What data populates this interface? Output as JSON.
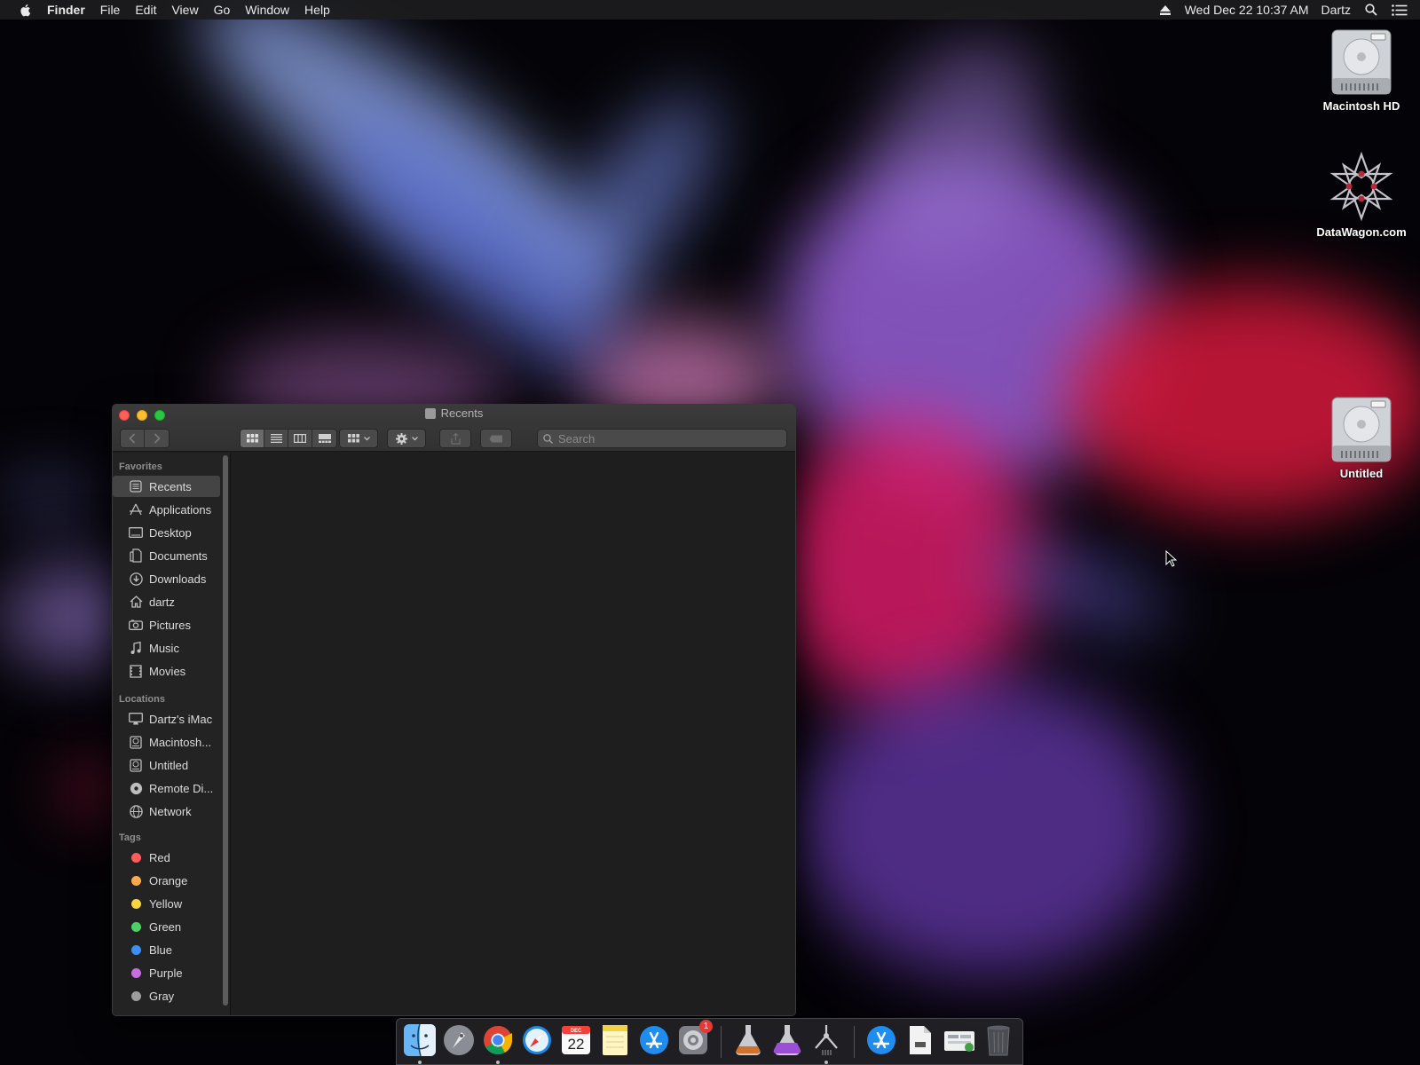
{
  "menubar": {
    "app_name": "Finder",
    "menus": [
      "File",
      "Edit",
      "View",
      "Go",
      "Window",
      "Help"
    ],
    "clock": "Wed Dec 22  10:37 AM",
    "user": "Dartz"
  },
  "desktop_icons": [
    {
      "label": "Macintosh HD",
      "icon": "hard-drive-icon"
    },
    {
      "label": "DataWagon.com",
      "icon": "datawagon-logo-icon"
    },
    {
      "label": "Untitled",
      "icon": "hard-drive-icon"
    }
  ],
  "window": {
    "title": "Recents",
    "search": {
      "placeholder": "Search",
      "value": ""
    },
    "view_mode": "icon"
  },
  "sidebar": {
    "favorites_header": "Favorites",
    "favorites": [
      {
        "label": "Recents",
        "icon": "recents-icon",
        "selected": true
      },
      {
        "label": "Applications",
        "icon": "applications-icon"
      },
      {
        "label": "Desktop",
        "icon": "desktop-icon"
      },
      {
        "label": "Documents",
        "icon": "documents-icon"
      },
      {
        "label": "Downloads",
        "icon": "downloads-icon"
      },
      {
        "label": "dartz",
        "icon": "home-icon"
      },
      {
        "label": "Pictures",
        "icon": "pictures-icon"
      },
      {
        "label": "Music",
        "icon": "music-icon"
      },
      {
        "label": "Movies",
        "icon": "movies-icon"
      }
    ],
    "locations_header": "Locations",
    "locations": [
      {
        "label": "Dartz's iMac",
        "icon": "imac-icon"
      },
      {
        "label": "Macintosh...",
        "icon": "disk-icon"
      },
      {
        "label": "Untitled",
        "icon": "disk-icon"
      },
      {
        "label": "Remote Di...",
        "icon": "remote-disc-icon"
      },
      {
        "label": "Network",
        "icon": "network-icon"
      }
    ],
    "tags_header": "Tags",
    "tags": [
      {
        "label": "Red",
        "color": "#ff5b5b"
      },
      {
        "label": "Orange",
        "color": "#ffa94a"
      },
      {
        "label": "Yellow",
        "color": "#f6d73c"
      },
      {
        "label": "Green",
        "color": "#4ed164"
      },
      {
        "label": "Blue",
        "color": "#3d8ef5"
      },
      {
        "label": "Purple",
        "color": "#c46ee0"
      },
      {
        "label": "Gray",
        "color": "#9d9d9d"
      }
    ]
  },
  "dock": {
    "apps": [
      {
        "name": "finder-icon",
        "running": true
      },
      {
        "name": "launchpad-icon",
        "running": false
      },
      {
        "name": "chrome-icon",
        "running": true
      },
      {
        "name": "safari-icon",
        "running": false
      },
      {
        "name": "calendar-icon",
        "running": false,
        "month": "DEC",
        "day": "22"
      },
      {
        "name": "notes-icon",
        "running": false
      },
      {
        "name": "app-store-icon",
        "running": false
      },
      {
        "name": "system-preferences-icon",
        "running": false,
        "badge": "1"
      },
      {
        "name": "installer-icon",
        "running": false
      },
      {
        "name": "installer-purple-icon",
        "running": false
      },
      {
        "name": "mojave-installer-icon",
        "running": true
      },
      {
        "name": "app-store-folder-icon",
        "running": false
      },
      {
        "name": "document-icon",
        "running": false
      },
      {
        "name": "downloads-stack-icon",
        "running": false
      },
      {
        "name": "trash-icon",
        "running": false
      }
    ]
  }
}
